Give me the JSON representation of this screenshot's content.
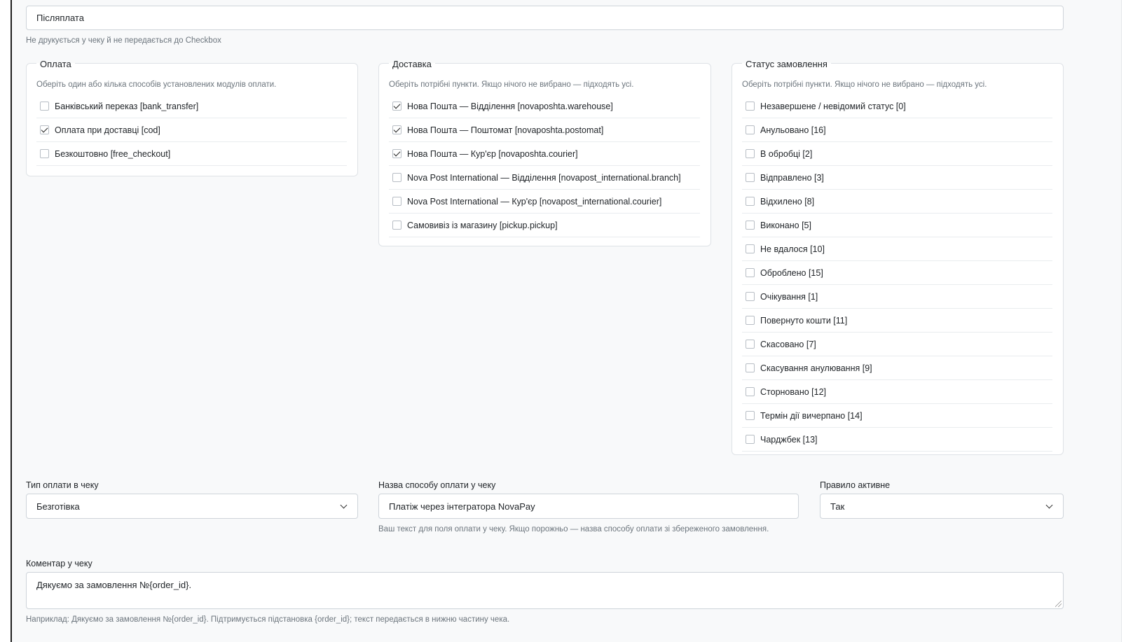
{
  "top_field": {
    "value": "Післяплата",
    "hint": "Не друкується у чеку й не передається до Checkbox"
  },
  "payment_group": {
    "legend": "Оплата",
    "hint": "Оберіть один або кілька способів установлених модулів оплати.",
    "items": [
      {
        "label": "Банківський переказ [bank_transfer]",
        "checked": false
      },
      {
        "label": "Оплата при доставці [cod]",
        "checked": true
      },
      {
        "label": "Безкоштовно [free_checkout]",
        "checked": false
      }
    ]
  },
  "delivery_group": {
    "legend": "Доставка",
    "hint": "Оберіть потрібні пункти. Якщо нічого не вибрано — підходять усі.",
    "items": [
      {
        "label": "Нова Пошта — Відділення [novaposhta.warehouse]",
        "checked": true
      },
      {
        "label": "Нова Пошта — Поштомат [novaposhta.postomat]",
        "checked": true
      },
      {
        "label": "Нова Пошта — Кур'єр [novaposhta.courier]",
        "checked": true
      },
      {
        "label": "Nova Post International — Відділення [novapost_international.branch]",
        "checked": false
      },
      {
        "label": "Nova Post International — Кур'єр [novapost_international.courier]",
        "checked": false
      },
      {
        "label": "Самовивіз із магазину [pickup.pickup]",
        "checked": false
      }
    ]
  },
  "status_group": {
    "legend": "Статус замовлення",
    "hint": "Оберіть потрібні пункти. Якщо нічого не вибрано — підходять усі.",
    "items": [
      {
        "label": "Незавершене / невідомий статус [0]",
        "checked": false
      },
      {
        "label": "Анульовано [16]",
        "checked": false
      },
      {
        "label": "В обробці [2]",
        "checked": false
      },
      {
        "label": "Відправлено [3]",
        "checked": false
      },
      {
        "label": "Відхилено [8]",
        "checked": false
      },
      {
        "label": "Виконано [5]",
        "checked": false
      },
      {
        "label": "Не вдалося [10]",
        "checked": false
      },
      {
        "label": "Оброблено [15]",
        "checked": false
      },
      {
        "label": "Очікування [1]",
        "checked": false
      },
      {
        "label": "Повернуто кошти [11]",
        "checked": false
      },
      {
        "label": "Скасовано [7]",
        "checked": false
      },
      {
        "label": "Скасування анулювання [9]",
        "checked": false
      },
      {
        "label": "Сторновано [12]",
        "checked": false
      },
      {
        "label": "Термін дії вичерпано [14]",
        "checked": false
      },
      {
        "label": "Чарджбек [13]",
        "checked": false
      }
    ]
  },
  "receipt_payment_type": {
    "label": "Тип оплати в чеку",
    "value": "Безготівка"
  },
  "receipt_payment_name": {
    "label": "Назва способу оплати у чеку",
    "value": "Платіж через інтегратора NovaPay",
    "hint": "Ваш текст для поля оплати у чеку. Якщо порожньо — назва способу оплати зі збереженого замовлення."
  },
  "rule_active": {
    "label": "Правило активне",
    "value": "Так"
  },
  "receipt_comment": {
    "label": "Коментар у чеку",
    "value": "Дякуємо за замовлення №{order_id}.",
    "hint": "Наприклад: Дякуємо за замовлення №{order_id}. Підтримується підстановка {order_id}; текст передається в нижню частину чека."
  }
}
